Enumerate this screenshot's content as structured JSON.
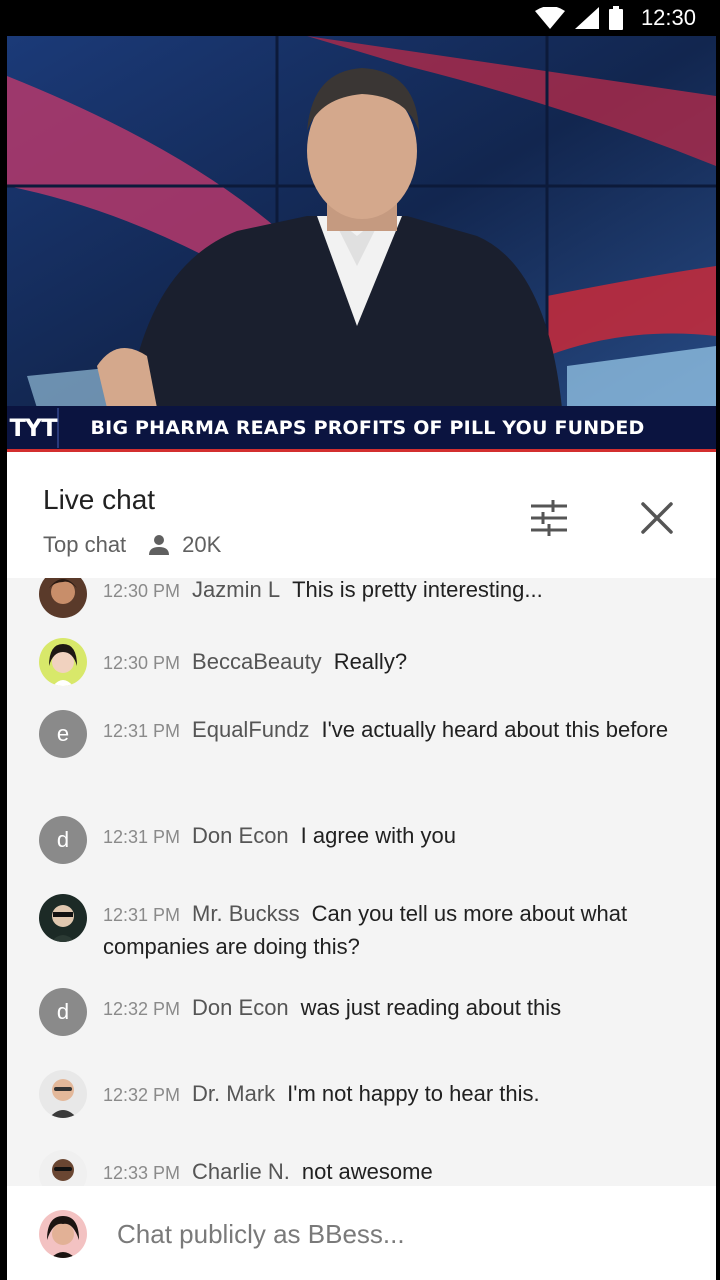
{
  "status_bar": {
    "time": "12:30"
  },
  "video": {
    "channel_logo": "TYT",
    "headline": "BIG PHARMA REAPS PROFITS OF PILL YOU FUNDED"
  },
  "chat": {
    "title": "Live chat",
    "mode": "Top chat",
    "viewers": "20K",
    "icons": {
      "viewers": "person-icon",
      "filter": "tune-icon",
      "close": "close-icon"
    }
  },
  "messages": [
    {
      "time": "12:30 PM",
      "author": "Jazmin L",
      "text": "This is pretty interesting...",
      "avatar": "photo"
    },
    {
      "time": "12:30 PM",
      "author": "BeccaBeauty",
      "text": "Really?",
      "avatar": "photo"
    },
    {
      "time": "12:31 PM",
      "author": "EqualFundz",
      "text": "I've actually heard about this before",
      "avatar": "e"
    },
    {
      "time": "12:31 PM",
      "author": "Don Econ",
      "text": "I agree with you",
      "avatar": "d"
    },
    {
      "time": "12:31 PM",
      "author": "Mr. Buckss",
      "text": "Can you tell us more about what companies are doing this?",
      "avatar": "photo"
    },
    {
      "time": "12:32 PM",
      "author": "Don Econ",
      "text": "was just reading about this",
      "avatar": "d"
    },
    {
      "time": "12:32 PM",
      "author": "Dr. Mark",
      "text": "I'm not happy to hear this.",
      "avatar": "photo"
    },
    {
      "time": "12:33 PM",
      "author": "Charlie N.",
      "text": "not awesome",
      "avatar": "photo"
    }
  ],
  "input": {
    "placeholder": "Chat publicly as BBess..."
  },
  "colors": {
    "accent_red": "#d32f2f",
    "banner_navy": "#0b1440",
    "chat_bg": "#f4f4f4"
  }
}
